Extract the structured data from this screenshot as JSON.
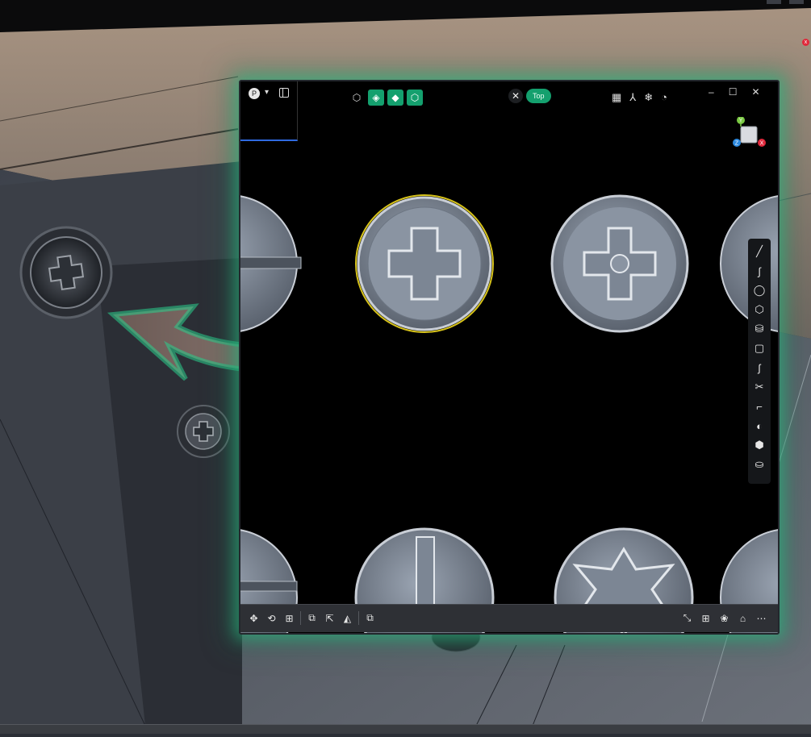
{
  "background_scene": {
    "description_icons": [
      "arrow-icon"
    ]
  },
  "popup": {
    "profile_initial": "P",
    "view_tag": {
      "close_icon": "✕",
      "label": "Top"
    },
    "gizmo": {
      "y_label": "Y",
      "x_label": "X",
      "z_label": "Z"
    },
    "window_controls": {
      "minimize": "–",
      "maximize": "☐",
      "close": "✕"
    },
    "colors": {
      "accent": "#14a06e",
      "glow": "#28be82",
      "selection": "#d6c21b"
    }
  },
  "corner_close_label": "x"
}
